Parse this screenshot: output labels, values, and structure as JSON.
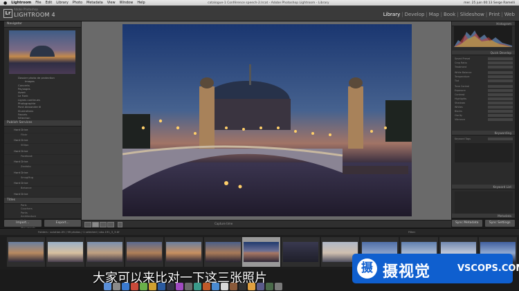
{
  "menubar": {
    "apple": "",
    "items": [
      "Lightroom",
      "File",
      "Edit",
      "Library",
      "Photo",
      "Metadata",
      "View",
      "Window",
      "Help"
    ],
    "window_title": "catalogue-1 Conférence speech-2.lrcat - Adobe Photoshop Lightroom - Library",
    "clock": "mer. 25 juin  00:13  Serge Ramelli"
  },
  "app": {
    "logo": "Lr",
    "small_title": "Adobe Photoshop",
    "name": "LIGHTROOM 4",
    "modules": [
      "Library",
      "Develop",
      "Map",
      "Book",
      "Slideshow",
      "Print",
      "Web"
    ],
    "active_module": "Library"
  },
  "left": {
    "navigator_title": "Navigator",
    "folders": [
      "Dossier photo de protection",
      "Images",
      "Concerts",
      "Paysages",
      "Avant",
      "Le Fonk",
      "Lignes continues",
      "Photographie",
      "Pont Alexandre III",
      "Illustrations",
      "Favoris",
      "Sélection"
    ],
    "publish_title": "Publish Services",
    "publish_services": [
      "Hard Drive",
      "Hard Drive",
      "Hard Drive",
      "Hard Drive",
      "Hard Drive",
      "Hard Drive",
      "Hard Drive"
    ],
    "publish_subs": [
      "Flickr",
      "500px",
      "Facebook",
      "Zenfolio",
      "SmugMug",
      "Behance",
      "Tumblr"
    ],
    "filter_title": "Titles",
    "filter_items": [
      "Paris",
      "Couchers",
      "Ponts",
      "Architecture",
      "Nuits",
      "Fontaines",
      "Monuments"
    ],
    "import_label": "Import...",
    "export_label": "Export..."
  },
  "toolbar": {
    "label": "Capture time"
  },
  "right": {
    "histogram_title": "Histogram",
    "quick_develop": "Quick Develop",
    "rows": [
      "Saved Preset",
      "Crop Ratio",
      "Treatment",
      "White Balance",
      "Temperature",
      "Tint",
      "Tone Control",
      "Exposure",
      "Contrast",
      "Highlights",
      "Shadows",
      "Whites",
      "Blacks",
      "Clarity",
      "Vibrance"
    ],
    "keywording": "Keywording",
    "keyword_tags": "Keyword Tags",
    "keyword_list": "Keyword List",
    "metadata": "Metadata",
    "sync_metadata": "Sync Metadata",
    "sync_settings": "Sync Settings"
  },
  "filmstrip": {
    "source": "Folders : solution-05  /  99 photos / 1 selected / oko-191_3_3.tif",
    "filter_label": "Filter:",
    "thumbs": 13,
    "selected_index": 6
  },
  "subtitle": "大家可以来比对一下这三张照片",
  "watermark": {
    "glyph": "摄",
    "cn": "摄视觉",
    "en": "VSCOPS.COM"
  }
}
